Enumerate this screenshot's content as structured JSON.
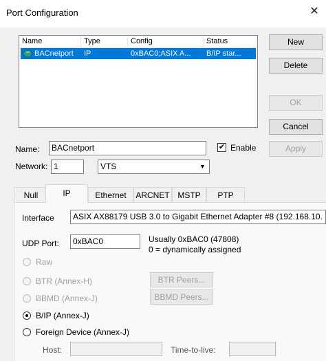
{
  "window": {
    "title": "Port Configuration",
    "close": "✕"
  },
  "list": {
    "columns": [
      "Name",
      "Type",
      "Config",
      "Status"
    ],
    "rows": [
      {
        "name": "BACnetport",
        "type": "IP",
        "config": "0xBAC0;ASIX A...",
        "status": "B/IP star...",
        "icon": "network-port-icon"
      }
    ]
  },
  "buttons": {
    "new": "New",
    "delete": "Delete",
    "ok": "OK",
    "cancel": "Cancel",
    "apply": "Apply",
    "btr_peers": "BTR Peers...",
    "bbmd_peers": "BBMD Peers..."
  },
  "form": {
    "name_label": "Name:",
    "name_value": "BACnetport",
    "enable_label": "Enable",
    "enable_checked": true,
    "network_label": "Network:",
    "network_value": "1",
    "network_type": "VTS"
  },
  "tabs": [
    "Null",
    "IP",
    "Ethernet",
    "ARCNET",
    "MSTP",
    "PTP"
  ],
  "active_tab": "IP",
  "ip": {
    "interface_label": "Interface",
    "interface_value": "ASIX AX88179 USB 3.0 to Gigabit Ethernet Adapter #8 (192.168.10.",
    "udp_label": "UDP Port:",
    "udp_value": "0xBAC0",
    "udp_hint1": "Usually 0xBAC0 (47808)",
    "udp_hint2": "0 = dynamically assigned",
    "modes": [
      {
        "label": "Raw",
        "enabled": false,
        "selected": false
      },
      {
        "label": "BTR (Annex-H)",
        "enabled": false,
        "selected": false
      },
      {
        "label": "BBMD (Annex-J)",
        "enabled": false,
        "selected": false
      },
      {
        "label": "B/IP (Annex-J)",
        "enabled": true,
        "selected": true
      },
      {
        "label": "Foreign Device (Annex-J)",
        "enabled": true,
        "selected": false
      }
    ],
    "host_label": "Host:",
    "host_value": "",
    "ttl_label": "Time-to-live:",
    "ttl_value": ""
  }
}
